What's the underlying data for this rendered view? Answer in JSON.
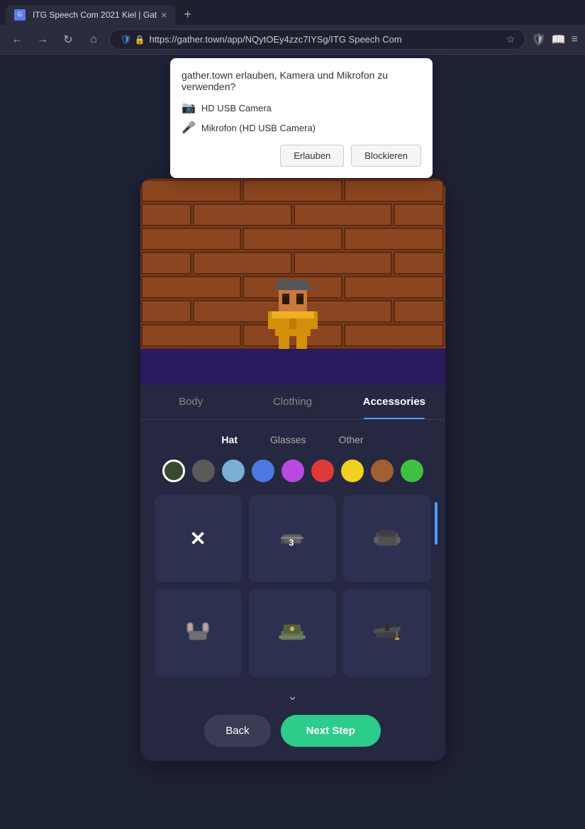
{
  "browser": {
    "tab_title": "ITG Speech Com 2021 Kiel | Gat",
    "tab_favicon": "🔵",
    "new_tab_icon": "+",
    "address": "https://gather.town/app/NQytOEy4zzc7IYSg/ITG Speech Com",
    "back_icon": "←",
    "forward_icon": "→",
    "reload_icon": "↻",
    "home_icon": "⌂",
    "close_icon": "×",
    "menu_icon": "≡",
    "profile_icon": "◎"
  },
  "permission_popup": {
    "title": "gather.town erlauben, Kamera und Mikrofon zu verwenden?",
    "camera_label": "HD USB Camera",
    "mic_label": "Mikrofon (HD USB Camera)",
    "allow_label": "Erlauben",
    "block_label": "Blockieren"
  },
  "character_editor": {
    "main_tabs": [
      {
        "id": "body",
        "label": "Body",
        "active": false
      },
      {
        "id": "clothing",
        "label": "Clothing",
        "active": false
      },
      {
        "id": "accessories",
        "label": "Accessories",
        "active": true
      }
    ],
    "sub_tabs": [
      {
        "id": "hat",
        "label": "Hat",
        "active": true
      },
      {
        "id": "glasses",
        "label": "Glasses",
        "active": false
      },
      {
        "id": "other",
        "label": "Other",
        "active": false
      }
    ],
    "colors": [
      {
        "id": "dark-green",
        "hex": "#3a4a2e",
        "selected": true
      },
      {
        "id": "gray",
        "hex": "#5a5a5a",
        "selected": false
      },
      {
        "id": "light-blue",
        "hex": "#7ab0d4",
        "selected": false
      },
      {
        "id": "blue",
        "hex": "#4a7adf",
        "selected": false
      },
      {
        "id": "purple",
        "hex": "#b84adf",
        "selected": false
      },
      {
        "id": "red",
        "hex": "#df3a3a",
        "selected": false
      },
      {
        "id": "yellow",
        "hex": "#f0d020",
        "selected": false
      },
      {
        "id": "brown",
        "hex": "#a06030",
        "selected": false
      },
      {
        "id": "green",
        "hex": "#40c040",
        "selected": false
      }
    ],
    "hat_items": [
      {
        "id": "none",
        "type": "none",
        "icon": "×",
        "label": "None"
      },
      {
        "id": "cap-3",
        "type": "cap",
        "icon": "🧢",
        "label": "Cap 3"
      },
      {
        "id": "beanie",
        "type": "beanie",
        "icon": "🪖",
        "label": "Beanie"
      },
      {
        "id": "ears",
        "type": "animal-ears",
        "icon": "🐱",
        "label": "Animal Ears"
      },
      {
        "id": "military",
        "type": "military",
        "icon": "⛑",
        "label": "Military Cap"
      },
      {
        "id": "grad",
        "type": "graduation",
        "icon": "🎓",
        "label": "Graduation Cap"
      }
    ],
    "buttons": {
      "back_label": "Back",
      "next_label": "Next Step"
    }
  }
}
